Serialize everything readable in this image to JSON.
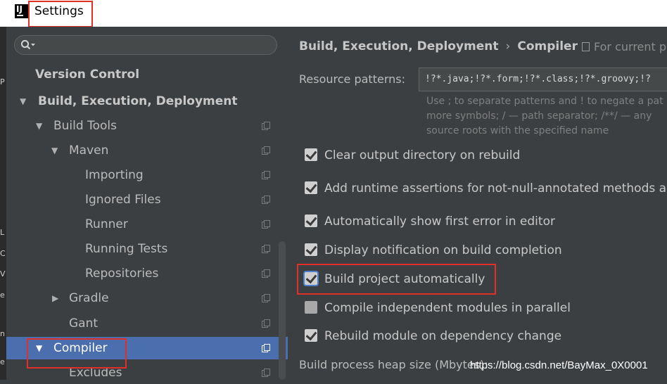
{
  "window": {
    "title": "Settings"
  },
  "search": {
    "placeholder": ""
  },
  "edge_strip": [
    "P",
    "L",
    "C",
    "V",
    "e",
    "n",
    "e"
  ],
  "tree": [
    {
      "label": "Version Control",
      "bold": true,
      "arrow": ""
    },
    {
      "label": "Build, Execution, Deployment",
      "bold": true,
      "arrow": "▼"
    },
    {
      "label": "Build Tools",
      "arrow": "▼",
      "copy": true
    },
    {
      "label": "Maven",
      "arrow": "▼",
      "copy": true
    },
    {
      "label": "Importing",
      "copy": true
    },
    {
      "label": "Ignored Files",
      "copy": true
    },
    {
      "label": "Runner",
      "copy": true
    },
    {
      "label": "Running Tests",
      "copy": true
    },
    {
      "label": "Repositories",
      "copy": true
    },
    {
      "label": "Gradle",
      "arrow": "▶",
      "copy": true
    },
    {
      "label": "Gant",
      "copy": true
    },
    {
      "label": "Compiler",
      "arrow": "▼",
      "copy": true,
      "selected": true
    },
    {
      "label": "Excludes",
      "copy": true
    }
  ],
  "breadcrumb": {
    "parent": "Build, Execution, Deployment",
    "separator": "›",
    "current": "Compiler"
  },
  "scope_hint": "For current p",
  "resource_patterns": {
    "label": "Resource patterns:",
    "value": "!?*.java;!?*.form;!?*.class;!?*.groovy;!?",
    "help_lines": [
      "Use ; to separate patterns and ! to negate a pat",
      "more symbols; / — path separator; /**/ — any",
      "source roots with the specified name"
    ]
  },
  "options": [
    {
      "label": "Clear output directory on rebuild",
      "checked": true
    },
    {
      "label": "Add runtime assertions for not-null-annotated methods and",
      "checked": true
    },
    {
      "label": "Automatically show first error in editor",
      "checked": true
    },
    {
      "label": "Display notification on build completion",
      "checked": true
    },
    {
      "label": "Build project automatically",
      "checked": true
    },
    {
      "label": "Compile independent modules in parallel",
      "checked": false
    },
    {
      "label": "Rebuild module on dependency change",
      "checked": true
    }
  ],
  "heap": {
    "label": "Build process heap size (Mbytes):"
  },
  "watermark": "https://blog.csdn.net/BayMax_0X0001",
  "colors": {
    "selection": "#4b6eaf",
    "highlight": "#e0302a",
    "panel": "#3c3f41"
  }
}
